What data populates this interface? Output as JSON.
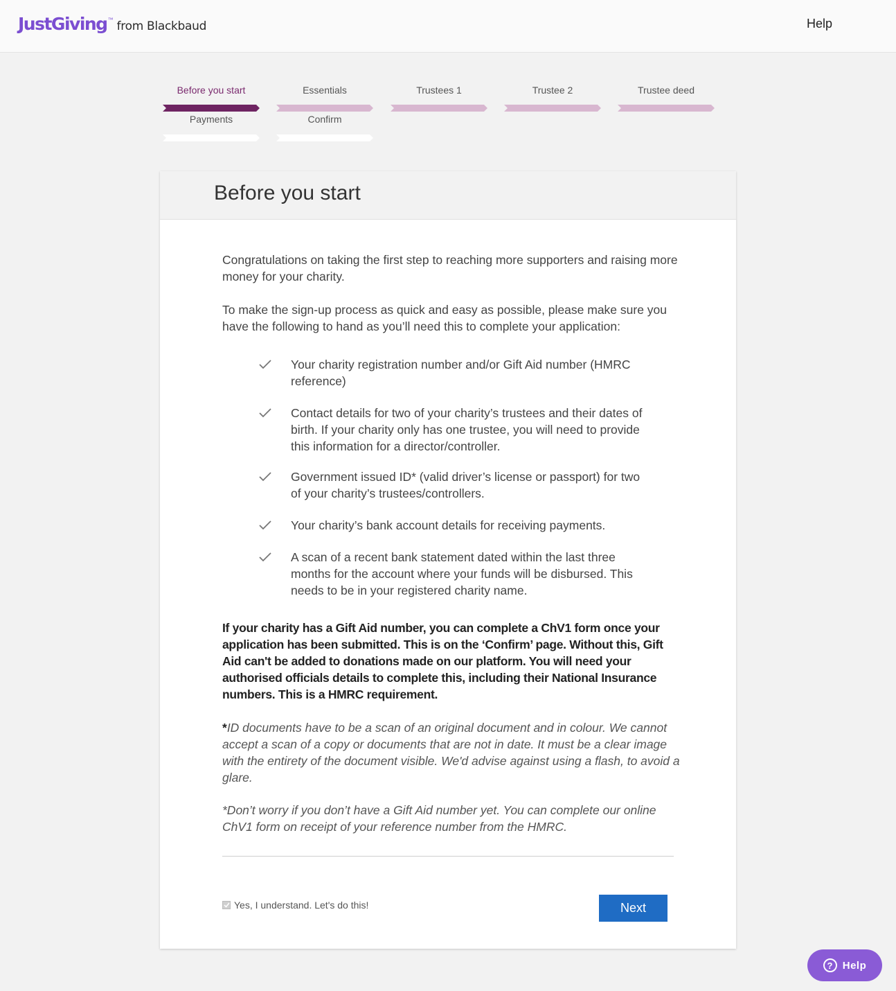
{
  "header": {
    "logo_main": "JustGiving",
    "logo_tm": "™",
    "logo_sub": "from Blackbaud",
    "help_link": "Help"
  },
  "steps": [
    {
      "label": "Before you start",
      "state": "active"
    },
    {
      "label": "Essentials",
      "state": "pending"
    },
    {
      "label": "Trustees 1",
      "state": "pending"
    },
    {
      "label": "Trustee 2",
      "state": "pending"
    },
    {
      "label": "Trustee deed",
      "state": "pending"
    },
    {
      "label": "Payments",
      "state": "pending"
    },
    {
      "label": "Confirm",
      "state": "pending"
    }
  ],
  "card": {
    "title": "Before you start",
    "intro1": "Congratulations on taking the first step to reaching more supporters and raising more money for your charity.",
    "intro2": "To make the sign-up process as quick and easy as possible, please make sure you have the following to hand as you’ll need this to complete your application:",
    "checklist": [
      "Your charity registration number and/or Gift Aid number (HMRC reference)",
      "Contact details for two of your charity’s trustees and their dates of birth. If your charity only has one trustee, you will need to provide this information for a director/controller.",
      "Government issued ID* (valid driver’s license or passport) for two of your charity’s trustees/controllers.",
      "Your charity’s bank account details for receiving payments.",
      "A scan of a recent bank statement dated within the last three months for the account where your funds will be disbursed. This needs to be in your registered charity name."
    ],
    "bold_note": "If your charity has a Gift Aid number, you can complete a ChV1 form once your application has been submitted. This is on the ‘Confirm’ page. Without this, Gift Aid can't be added to donations made on our platform. You will need your authorised officials details to complete this, including their National Insurance numbers. This is a HMRC requirement.",
    "id_note_star": "*",
    "id_note": "ID documents have to be a scan of an original document and in colour. We cannot accept a scan of a copy or documents that are not in date. It must be a clear image with the entirety of the document visible. We'd advise against using a flash, to avoid a glare.",
    "gift_aid_note": "*Don’t worry if you don’t have a Gift Aid number yet. You can complete our online ChV1 form on receipt of your reference number from the HMRC.",
    "agree_label": "Yes, I understand. Let's do this!",
    "agree_checked": true,
    "next_button": "Next"
  },
  "float_help": "Help",
  "colors": {
    "brand_purple": "#7b4ed1",
    "step_active": "#6e2462",
    "step_pending": "#d8b7d0",
    "button_blue": "#1f6cc4"
  }
}
